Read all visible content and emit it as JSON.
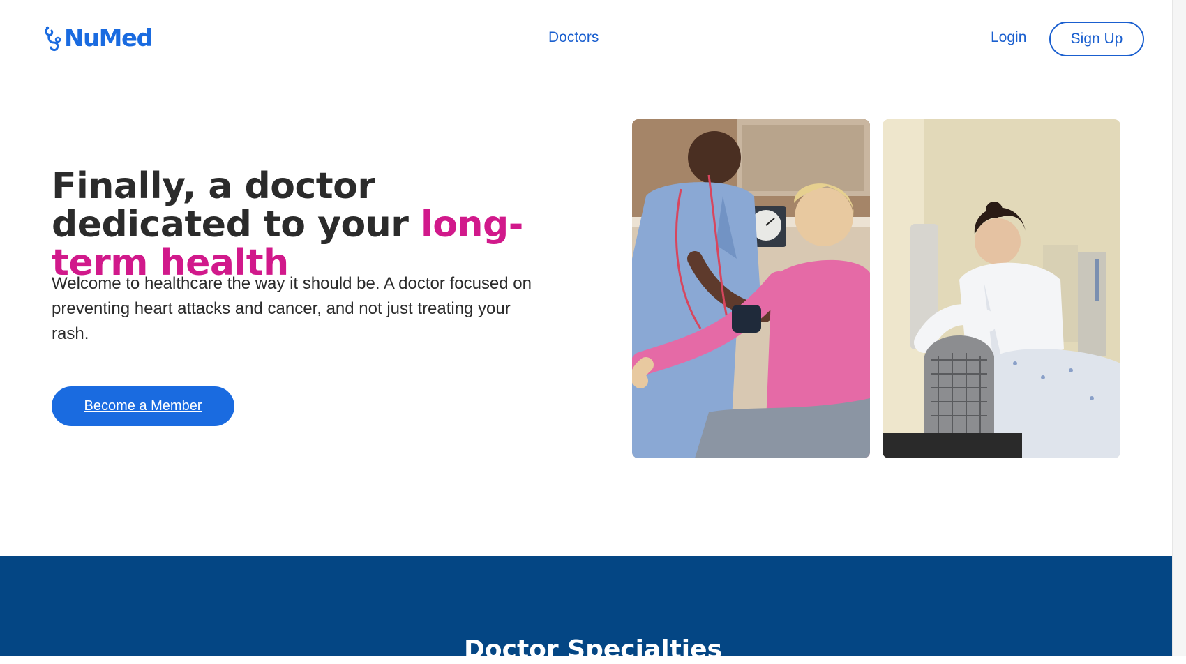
{
  "brand": {
    "name": "NuMed",
    "color": "#1a6be0"
  },
  "nav": {
    "doctors_label": "Doctors",
    "login_label": "Login",
    "signup_label": "Sign Up"
  },
  "hero": {
    "title_part1": "Finally, a doctor dedicated to your ",
    "title_accent": "long-term health",
    "accent_color": "#d1198b",
    "description": "Welcome to healthcare the way it should be. A doctor focused on preventing heart attacks and cancer, and not just treating your rash.",
    "cta_label": "Become a Member",
    "cta_color": "#1a6be0"
  },
  "photos": [
    {
      "subject": "nurse measuring blood pressure of patient"
    },
    {
      "subject": "doctor preparing patient for scan"
    }
  ],
  "specialties": {
    "title": "Doctor Specialties",
    "background": "#044684"
  }
}
